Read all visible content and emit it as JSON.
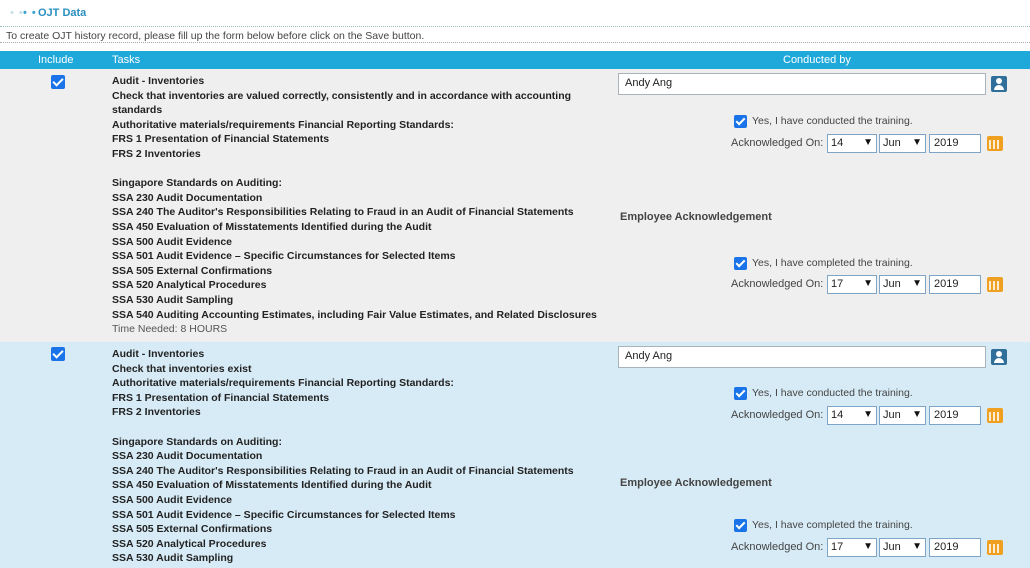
{
  "section": {
    "dots_light": "• •",
    "dots_dark": "• •",
    "title": "OJT Data"
  },
  "instructions": "To create OJT history record, please fill up the form below before click on the Save button.",
  "table": {
    "headers": {
      "include": "Include",
      "tasks": "Tasks",
      "conducted_by": "Conducted by"
    }
  },
  "icons": {
    "include_checkbox": "checkbox-checked",
    "person": "person-lookup-icon",
    "calendar": "calendar-icon",
    "dropdown": "▼"
  },
  "colors": {
    "header_bg": "#1fa8da",
    "row1_bg": "#efefef",
    "row2_bg": "#d7ebf6",
    "checkbox": "#1a73e8",
    "calendar": "#f0a020"
  },
  "rows": [
    {
      "included": true,
      "tasks": [
        "Audit - Inventories",
        "Check that inventories are valued correctly, consistently and in accordance with accounting",
        "standards",
        "Authoritative materials/requirements Financial Reporting Standards:",
        "FRS 1 Presentation of Financial Statements",
        "FRS 2 Inventories",
        "",
        "Singapore Standards on Auditing:",
        "SSA 230 Audit Documentation",
        "SSA 240 The Auditor's Responsibilities Relating to Fraud in an Audit of Financial Statements",
        "SSA 450 Evaluation of Misstatements Identified during the Audit",
        "SSA 500 Audit Evidence",
        "SSA 501 Audit Evidence – Specific Circumstances for Selected Items",
        "SSA 505 External Confirmations",
        "SSA 520 Analytical Procedures",
        "SSA 530 Audit Sampling",
        "SSA 540 Auditing Accounting Estimates, including Fair Value Estimates, and Related Disclosures"
      ],
      "time_needed": "Time Needed: 8 HOURS",
      "conducted_by": "Andy Ang",
      "conducted_confirm": "Yes, I have conducted the training.",
      "ack_label": "Acknowledged On:",
      "conducted_date": {
        "day": "14",
        "month": "Jun",
        "year": "2019"
      },
      "employee_ack_title": "Employee Acknowledgement",
      "completed_confirm": "Yes, I have completed the training.",
      "completed_date": {
        "day": "17",
        "month": "Jun",
        "year": "2019"
      }
    },
    {
      "included": true,
      "tasks": [
        "Audit - Inventories",
        "Check that inventories exist",
        "Authoritative materials/requirements Financial Reporting Standards:",
        "FRS 1 Presentation of Financial Statements",
        "FRS 2 Inventories",
        "",
        "Singapore Standards on Auditing:",
        "SSA 230 Audit Documentation",
        "SSA 240 The Auditor's Responsibilities Relating to Fraud in an Audit of Financial Statements",
        "SSA 450 Evaluation of Misstatements Identified during the Audit",
        "SSA 500 Audit Evidence",
        "SSA 501 Audit Evidence – Specific Circumstances for Selected Items",
        "SSA 505 External Confirmations",
        "SSA 520 Analytical Procedures",
        "SSA 530 Audit Sampling"
      ],
      "conducted_by": "Andy Ang",
      "conducted_confirm": "Yes, I have conducted the training.",
      "ack_label": "Acknowledged On:",
      "conducted_date": {
        "day": "14",
        "month": "Jun",
        "year": "2019"
      },
      "employee_ack_title": "Employee Acknowledgement",
      "completed_confirm": "Yes, I have completed the training.",
      "completed_date": {
        "day": "17",
        "month": "Jun",
        "year": "2019"
      }
    }
  ]
}
